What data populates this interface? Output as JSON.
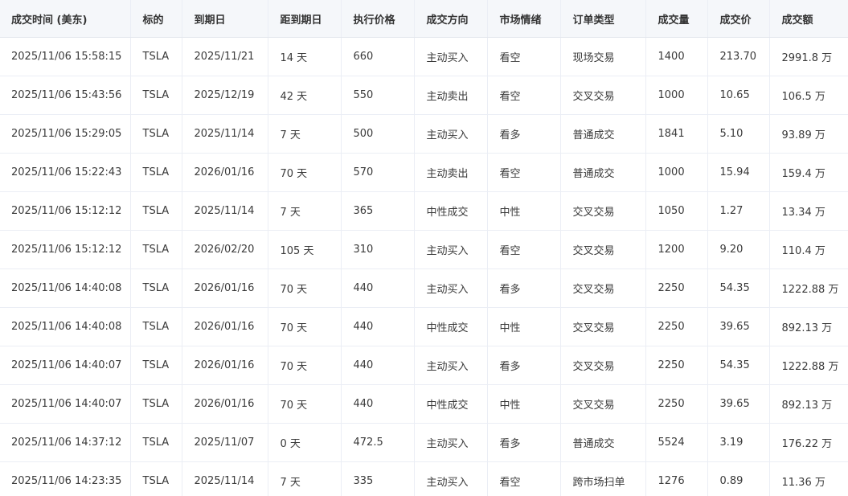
{
  "columns": [
    "成交时间 (美东)",
    "标的",
    "到期日",
    "距到期日",
    "执行价格",
    "成交方向",
    "市场情绪",
    "订单类型",
    "成交量",
    "成交价",
    "成交额"
  ],
  "rows": [
    [
      "2025/11/06 15:58:15",
      "TSLA",
      "2025/11/21",
      "14 天",
      "660",
      "主动买入",
      "看空",
      "现场交易",
      "1400",
      "213.70",
      "2991.8 万"
    ],
    [
      "2025/11/06 15:43:56",
      "TSLA",
      "2025/12/19",
      "42 天",
      "550",
      "主动卖出",
      "看空",
      "交叉交易",
      "1000",
      "10.65",
      "106.5 万"
    ],
    [
      "2025/11/06 15:29:05",
      "TSLA",
      "2025/11/14",
      "7 天",
      "500",
      "主动买入",
      "看多",
      "普通成交",
      "1841",
      "5.10",
      "93.89 万"
    ],
    [
      "2025/11/06 15:22:43",
      "TSLA",
      "2026/01/16",
      "70 天",
      "570",
      "主动卖出",
      "看空",
      "普通成交",
      "1000",
      "15.94",
      "159.4 万"
    ],
    [
      "2025/11/06 15:12:12",
      "TSLA",
      "2025/11/14",
      "7 天",
      "365",
      "中性成交",
      "中性",
      "交叉交易",
      "1050",
      "1.27",
      "13.34 万"
    ],
    [
      "2025/11/06 15:12:12",
      "TSLA",
      "2026/02/20",
      "105 天",
      "310",
      "主动买入",
      "看空",
      "交叉交易",
      "1200",
      "9.20",
      "110.4 万"
    ],
    [
      "2025/11/06 14:40:08",
      "TSLA",
      "2026/01/16",
      "70 天",
      "440",
      "主动买入",
      "看多",
      "交叉交易",
      "2250",
      "54.35",
      "1222.88 万"
    ],
    [
      "2025/11/06 14:40:08",
      "TSLA",
      "2026/01/16",
      "70 天",
      "440",
      "中性成交",
      "中性",
      "交叉交易",
      "2250",
      "39.65",
      "892.13 万"
    ],
    [
      "2025/11/06 14:40:07",
      "TSLA",
      "2026/01/16",
      "70 天",
      "440",
      "主动买入",
      "看多",
      "交叉交易",
      "2250",
      "54.35",
      "1222.88 万"
    ],
    [
      "2025/11/06 14:40:07",
      "TSLA",
      "2026/01/16",
      "70 天",
      "440",
      "中性成交",
      "中性",
      "交叉交易",
      "2250",
      "39.65",
      "892.13 万"
    ],
    [
      "2025/11/06 14:37:12",
      "TSLA",
      "2025/11/07",
      "0 天",
      "472.5",
      "主动买入",
      "看多",
      "普通成交",
      "5524",
      "3.19",
      "176.22 万"
    ],
    [
      "2025/11/06 14:23:35",
      "TSLA",
      "2025/11/14",
      "7 天",
      "335",
      "主动买入",
      "看空",
      "跨市场扫单",
      "1276",
      "0.89",
      "11.36 万"
    ]
  ]
}
